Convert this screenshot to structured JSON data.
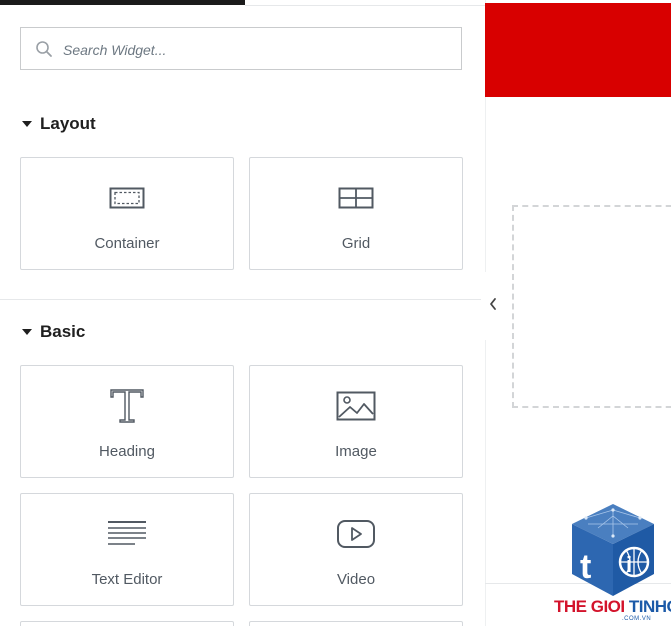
{
  "search": {
    "placeholder": "Search Widget..."
  },
  "sections": [
    {
      "title": "Layout",
      "widgets": [
        {
          "label": "Container",
          "icon": "container-icon"
        },
        {
          "label": "Grid",
          "icon": "grid-icon"
        }
      ]
    },
    {
      "title": "Basic",
      "widgets": [
        {
          "label": "Heading",
          "icon": "heading-icon"
        },
        {
          "label": "Image",
          "icon": "image-icon"
        },
        {
          "label": "Text Editor",
          "icon": "text-editor-icon"
        },
        {
          "label": "Video",
          "icon": "video-icon"
        }
      ]
    }
  ],
  "watermark": {
    "brand_part1": "THE GIOI",
    "brand_part2": "TINHOC",
    "domain": ".COM.VN"
  },
  "colors": {
    "banner_red": "#d80000",
    "icon_gray": "#515962",
    "brand_red": "#d3132b",
    "brand_blue": "#1c5aa8"
  }
}
